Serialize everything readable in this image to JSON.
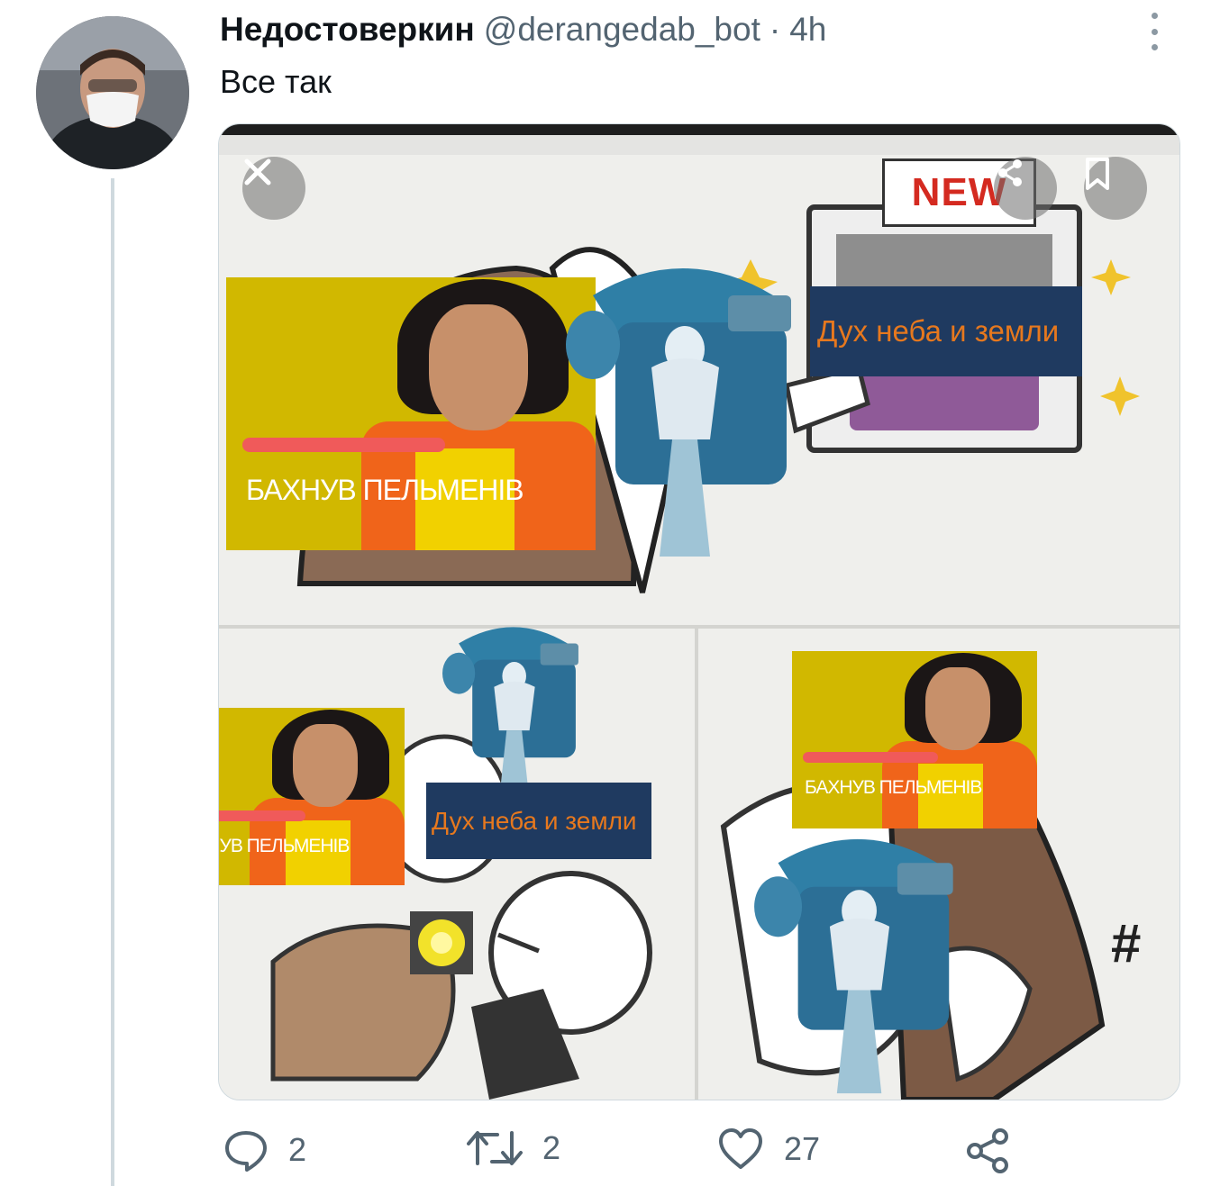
{
  "tweet": {
    "author_name": "Недостоверкин",
    "handle": "@derangedab_bot",
    "separator": "·",
    "time": "4h",
    "text": "Все так"
  },
  "media": {
    "sign_text": "NEW",
    "meme_caption": "БАХНУВ ПЕЛЬМЕНІВ",
    "label_text": "Дух неба и земли"
  },
  "actions": {
    "reply_count": "2",
    "retweet_count": "2",
    "like_count": "27"
  },
  "colors": {
    "label_bg": "#1f3a60",
    "label_text": "#e6781e",
    "meme_bg": "#d1b800",
    "icon_gray": "#536471"
  }
}
